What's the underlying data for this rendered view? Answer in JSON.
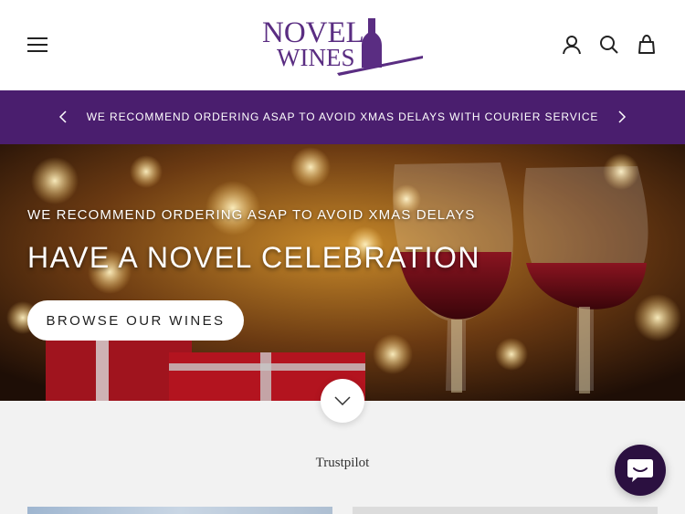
{
  "header": {
    "brand_line1": "NOVEL",
    "brand_line2": "WINES",
    "icons": [
      "menu-icon",
      "account-icon",
      "search-icon",
      "cart-icon"
    ]
  },
  "announcement": {
    "text": "WE RECOMMEND ORDERING ASAP TO AVOID XMAS DELAYS WITH COURIER SERVICE",
    "icons": [
      "chevron-left-icon",
      "chevron-right-icon"
    ]
  },
  "hero": {
    "eyebrow": "WE RECOMMEND ORDERING ASAP TO AVOID XMAS DELAYS",
    "title": "HAVE A NOVEL CELEBRATION",
    "button_label": "BROWSE OUR WINES"
  },
  "trustpilot": {
    "label": "Trustpilot"
  },
  "colors": {
    "brand_purple": "#4a1e6e",
    "chat_purple": "#2b1040",
    "page_bg": "#f2f2f2"
  }
}
